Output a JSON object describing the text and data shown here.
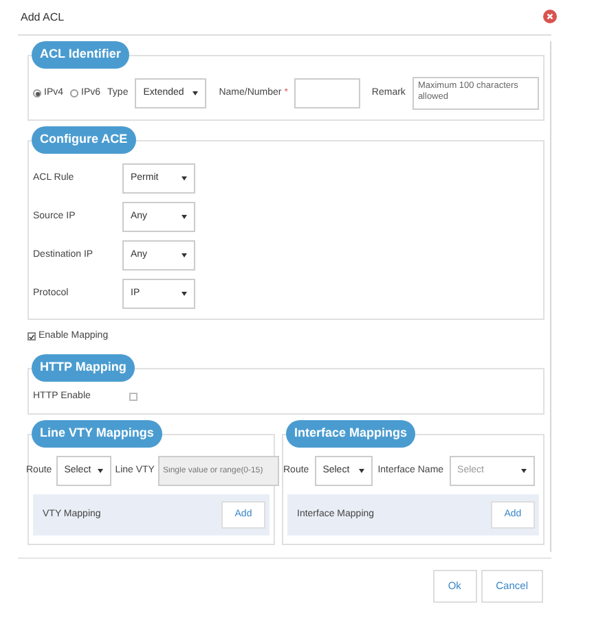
{
  "dialog": {
    "title": "Add ACL"
  },
  "acl_identifier": {
    "title": "ACL Identifier",
    "ip_versions": [
      {
        "label": "IPv4",
        "selected": true
      },
      {
        "label": "IPv6",
        "selected": false
      }
    ],
    "type_label": "Type",
    "type_value": "Extended",
    "name_label": "Name/Number",
    "required_mark": "*",
    "remark_label": "Remark",
    "remark_placeholder": "Maximum 100 characters allowed"
  },
  "configure_ace": {
    "title": "Configure ACE",
    "fields": [
      {
        "label": "ACL Rule",
        "value": "Permit"
      },
      {
        "label": "Source IP",
        "value": "Any"
      },
      {
        "label": "Destination IP",
        "value": "Any"
      },
      {
        "label": "Protocol",
        "value": "IP"
      }
    ]
  },
  "enable_mapping": {
    "label": "Enable Mapping",
    "checked": true
  },
  "http_mapping": {
    "title": "HTTP Mapping",
    "enable_label": "HTTP Enable",
    "checked": false
  },
  "line_vty_mappings": {
    "title": "Line VTY Mappings",
    "route_label": "Route",
    "route_value": "Select",
    "line_vty_label": "Line VTY",
    "line_vty_placeholder": "Single value or range(0-15)",
    "table_header": "VTY Mapping",
    "add_button": "Add"
  },
  "interface_mappings": {
    "title": "Interface Mappings",
    "route_label": "Route",
    "route_value": "Select",
    "interface_name_label": "Interface Name",
    "interface_name_value": "Select",
    "table_header": "Interface Mapping",
    "add_button": "Add"
  },
  "buttons": [
    {
      "label": "Ok"
    },
    {
      "label": "Cancel"
    }
  ]
}
